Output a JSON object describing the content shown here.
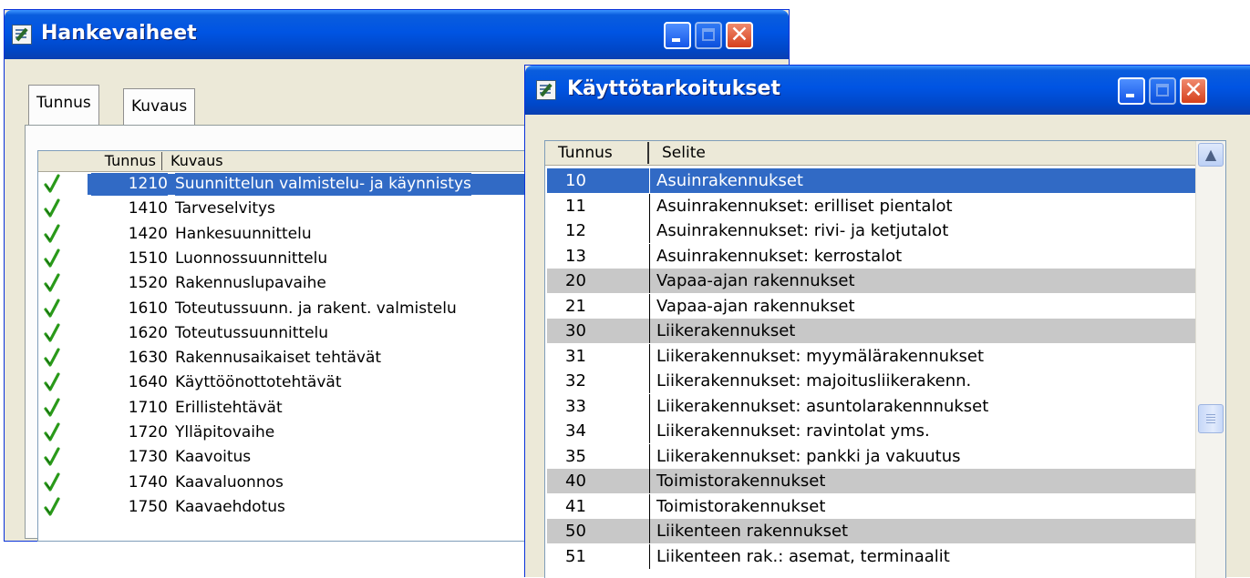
{
  "window1": {
    "title": "Hankevaiheet",
    "tabs": [
      "Tunnus",
      "Kuvaus"
    ],
    "columns": [
      "Tunnus",
      "Kuvaus"
    ],
    "rows": [
      {
        "code": "1210",
        "desc": "Suunnittelun valmistelu- ja käynnistys",
        "selected": true
      },
      {
        "code": "1410",
        "desc": "Tarveselvitys"
      },
      {
        "code": "1420",
        "desc": "Hankesuunnittelu"
      },
      {
        "code": "1510",
        "desc": "Luonnossuunnittelu"
      },
      {
        "code": "1520",
        "desc": "Rakennuslupavaihe"
      },
      {
        "code": "1610",
        "desc": "Toteutussuunn. ja rakent. valmistelu"
      },
      {
        "code": "1620",
        "desc": "Toteutussuunnittelu"
      },
      {
        "code": "1630",
        "desc": "Rakennusaikaiset tehtävät"
      },
      {
        "code": "1640",
        "desc": "Käyttöönottotehtävät"
      },
      {
        "code": "1710",
        "desc": "Erillistehtävät"
      },
      {
        "code": "1720",
        "desc": "Ylläpitovaihe"
      },
      {
        "code": "1730",
        "desc": "Kaavoitus"
      },
      {
        "code": "1740",
        "desc": "Kaavaluonnos"
      },
      {
        "code": "1750",
        "desc": "Kaavaehdotus"
      }
    ]
  },
  "window2": {
    "title": "Käyttötarkoitukset",
    "columns": [
      "Tunnus",
      "Selite"
    ],
    "rows": [
      {
        "code": "10",
        "desc": "Asuinrakennukset",
        "style": "selected"
      },
      {
        "code": "11",
        "desc": "Asuinrakennukset: erilliset pientalot",
        "style": "normal"
      },
      {
        "code": "12",
        "desc": "Asuinrakennukset: rivi- ja ketjutalot",
        "style": "normal"
      },
      {
        "code": "13",
        "desc": "Asuinrakennukset: kerrostalot",
        "style": "normal"
      },
      {
        "code": "20",
        "desc": "Vapaa-ajan rakennukset",
        "style": "grey"
      },
      {
        "code": "21",
        "desc": "Vapaa-ajan rakennukset",
        "style": "normal"
      },
      {
        "code": "30",
        "desc": "Liikerakennukset",
        "style": "grey"
      },
      {
        "code": "31",
        "desc": "Liikerakennukset: myymälärakennukset",
        "style": "normal"
      },
      {
        "code": "32",
        "desc": "Liikerakennukset: majoitusliikerakenn.",
        "style": "normal"
      },
      {
        "code": "33",
        "desc": "Liikerakennukset: asuntolarakennnukset",
        "style": "normal"
      },
      {
        "code": "34",
        "desc": "Liikerakennukset: ravintolat yms.",
        "style": "normal"
      },
      {
        "code": "35",
        "desc": "Liikerakennukset: pankki ja vakuutus",
        "style": "normal"
      },
      {
        "code": "40",
        "desc": "Toimistorakennukset",
        "style": "grey"
      },
      {
        "code": "41",
        "desc": "Toimistorakennukset",
        "style": "normal"
      },
      {
        "code": "50",
        "desc": "Liikenteen rakennukset",
        "style": "grey"
      },
      {
        "code": "51",
        "desc": "Liikenteen rak.: asemat, terminaalit",
        "style": "normal"
      }
    ]
  },
  "icons": {
    "window_icon": "form-edit-icon",
    "checkmark": "checkmark-icon",
    "minimize": "minimize-icon",
    "maximize": "maximize-icon",
    "close": "close-icon",
    "scroll_up": "chevron-up-icon"
  },
  "colors": {
    "titlebar": "#0054e3",
    "selection": "#316ac5",
    "group_row": "#c8c8c8",
    "checkmark": "#2a9a1a",
    "close_button": "#d6401c"
  }
}
